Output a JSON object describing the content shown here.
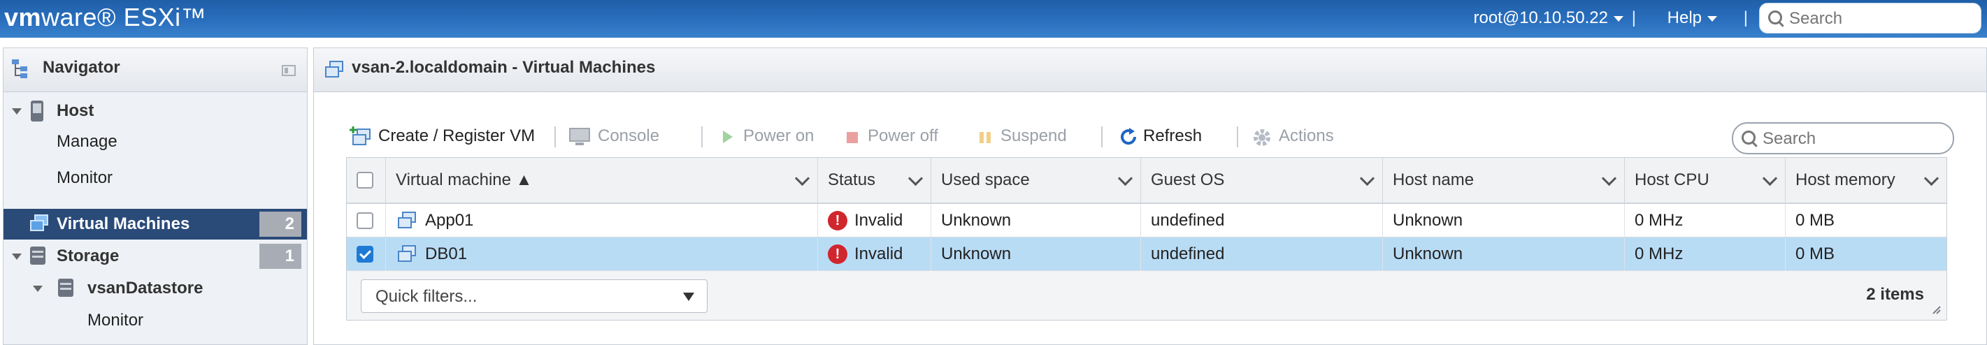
{
  "header": {
    "logo_vm": "vm",
    "logo_rest": "ware® ESXi™",
    "user": "root@10.10.50.22",
    "separator": "|",
    "help": "Help",
    "search_placeholder": "Search"
  },
  "navigator": {
    "title": "Navigator",
    "items": [
      {
        "label": "Host",
        "icon": "host-icon"
      },
      {
        "label": "Manage"
      },
      {
        "label": "Monitor"
      },
      {
        "label": "Virtual Machines",
        "icon": "vm-icon",
        "count": "2",
        "selected": true
      },
      {
        "label": "Storage",
        "icon": "storage-icon",
        "count": "1"
      },
      {
        "label": "vsanDatastore",
        "icon": "datastore-icon"
      },
      {
        "label": "Monitor"
      }
    ]
  },
  "main": {
    "title": "vsan-2.localdomain - Virtual Machines",
    "toolbar": {
      "create": "Create / Register VM",
      "console": "Console",
      "power_on": "Power on",
      "power_off": "Power off",
      "suspend": "Suspend",
      "refresh": "Refresh",
      "actions": "Actions"
    },
    "search_placeholder": "Search",
    "columns": [
      "Virtual machine ▲",
      "Status",
      "Used space",
      "Guest OS",
      "Host name",
      "Host CPU",
      "Host memory"
    ],
    "rows": [
      {
        "name": "App01",
        "status": "Invalid",
        "used_space": "Unknown",
        "guest_os": "undefined",
        "host_name": "Unknown",
        "host_cpu": "0 MHz",
        "host_memory": "0 MB",
        "checked": false
      },
      {
        "name": "DB01",
        "status": "Invalid",
        "used_space": "Unknown",
        "guest_os": "undefined",
        "host_name": "Unknown",
        "host_cpu": "0 MHz",
        "host_memory": "0 MB",
        "checked": true
      }
    ],
    "quick_filters": "Quick filters...",
    "items_count": "2 items"
  },
  "colors": {
    "topbar": "#2a6fbe",
    "selected_nav": "#2a4a78",
    "selected_row": "#b9dcf5",
    "error": "#d0262d"
  }
}
